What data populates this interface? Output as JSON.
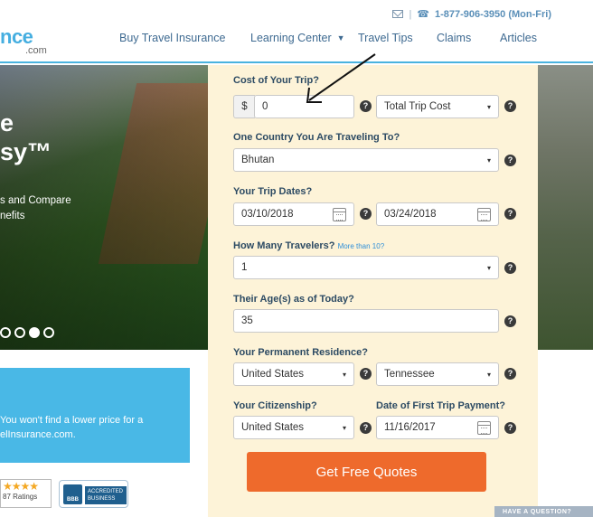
{
  "header": {
    "logo_text": "nce",
    "logo_sub": ".com",
    "phone": "1-877-906-3950 (Mon-Fri)",
    "nav": [
      "Buy Travel Insurance",
      "Learning Center",
      "Travel Tips",
      "Claims",
      "Articles"
    ]
  },
  "hero": {
    "line1": "e",
    "line2": "sy™",
    "sub1": "s and Compare",
    "sub2": "nefits"
  },
  "promo": {
    "line1": "You won't find a lower price for a",
    "line2": "elInsurance.com."
  },
  "ratings": {
    "stars": "★★★★",
    "text": "87 Ratings"
  },
  "bbb": {
    "logo": "BBB",
    "text": "ACCREDITED BUSINESS"
  },
  "form": {
    "cost_label": "Cost of Your Trip?",
    "currency_symbol": "$",
    "cost_value": "0",
    "cost_type": "Total Trip Cost",
    "country_label": "One Country You Are Traveling To?",
    "country_value": "Bhutan",
    "dates_label": "Your Trip Dates?",
    "date_start": "03/10/2018",
    "date_end": "03/24/2018",
    "travelers_label": "How Many Travelers?",
    "travelers_link": "More than 10?",
    "travelers_value": "1",
    "age_label": "Their Age(s) as of Today?",
    "age_value": "35",
    "residence_label": "Your Permanent Residence?",
    "residence_country": "United States",
    "residence_state": "Tennessee",
    "citizenship_label": "Your Citizenship?",
    "citizenship_value": "United States",
    "payment_label": "Date of First Trip Payment?",
    "payment_value": "11/16/2017",
    "submit_label": "Get Free Quotes"
  },
  "question_tab": "HAVE A QUESTION?",
  "icons": {
    "help": "?",
    "caret": "▾"
  }
}
